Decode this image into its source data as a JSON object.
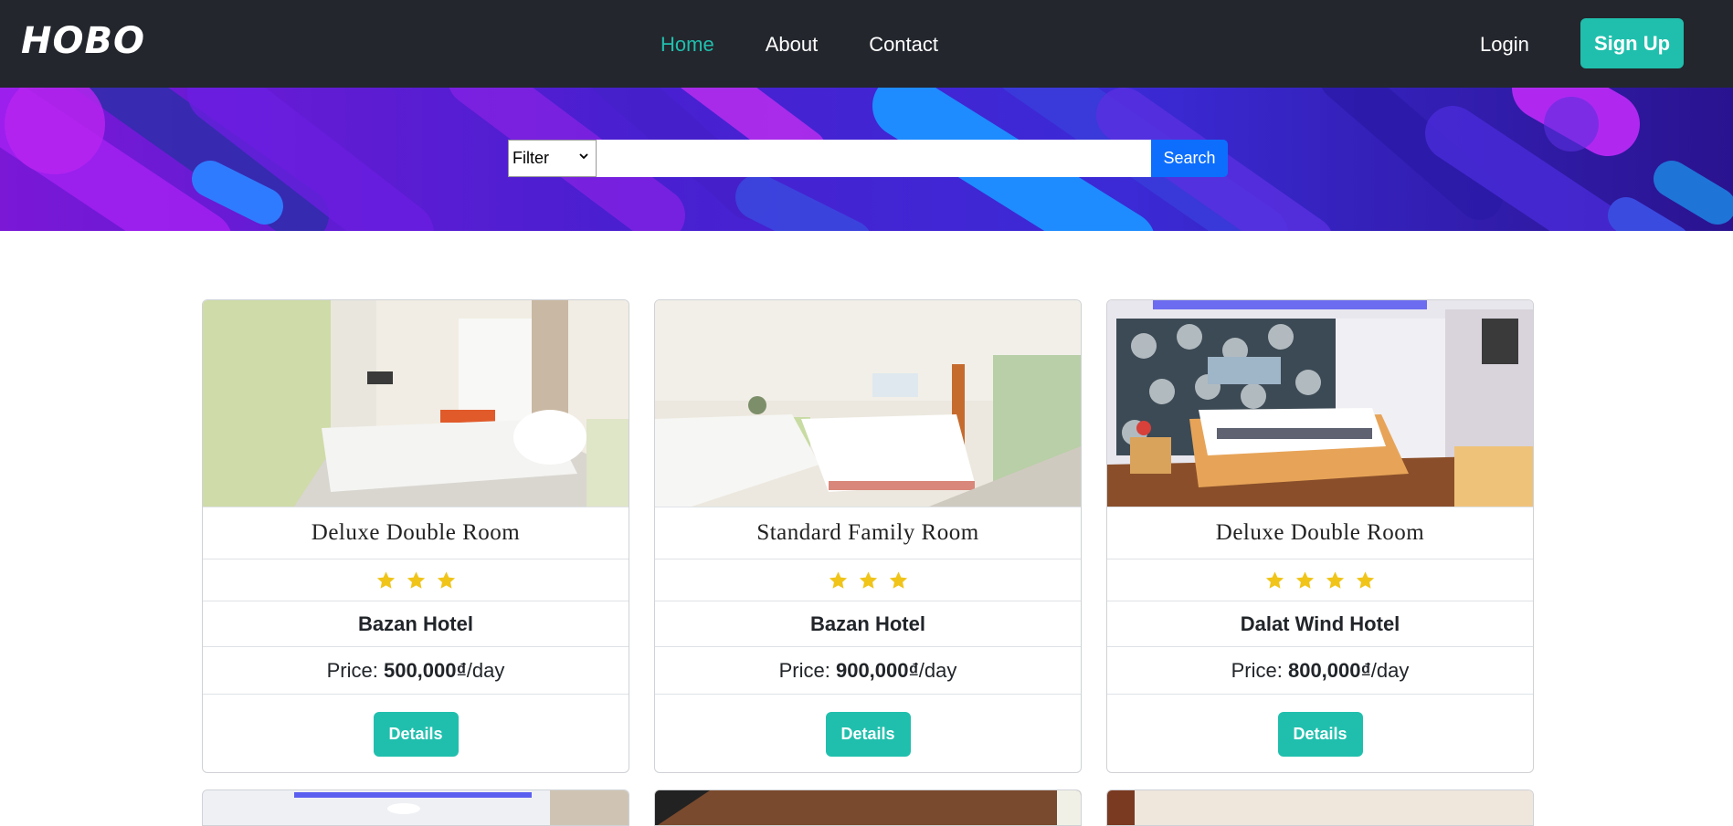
{
  "navbar": {
    "brand": "HOBO",
    "links": [
      {
        "label": "Home",
        "active": true
      },
      {
        "label": "About",
        "active": false
      },
      {
        "label": "Contact",
        "active": false
      }
    ],
    "login_label": "Login",
    "signup_label": "Sign Up"
  },
  "search": {
    "filter_selected": "Filter",
    "query_value": "",
    "button_label": "Search"
  },
  "rooms": [
    {
      "room_type": "Deluxe Double Room",
      "stars": 3,
      "hotel": "Bazan Hotel",
      "price_prefix": "Price: ",
      "price": "500,000₫",
      "price_suffix": "/day",
      "details_label": "Details"
    },
    {
      "room_type": "Standard Family Room",
      "stars": 3,
      "hotel": "Bazan Hotel",
      "price_prefix": "Price: ",
      "price": "900,000₫",
      "price_suffix": "/day",
      "details_label": "Details"
    },
    {
      "room_type": "Deluxe Double Room",
      "stars": 4,
      "hotel": "Dalat Wind Hotel",
      "price_prefix": "Price: ",
      "price": "800,000₫",
      "price_suffix": "/day",
      "details_label": "Details"
    }
  ],
  "colors": {
    "navbar_bg": "#23262d",
    "accent": "#20bfad",
    "search_button": "#0d6efd",
    "star": "#f0c419"
  },
  "icons": {
    "star": "star-icon",
    "filter_dropdown": "chevron-down-icon"
  }
}
